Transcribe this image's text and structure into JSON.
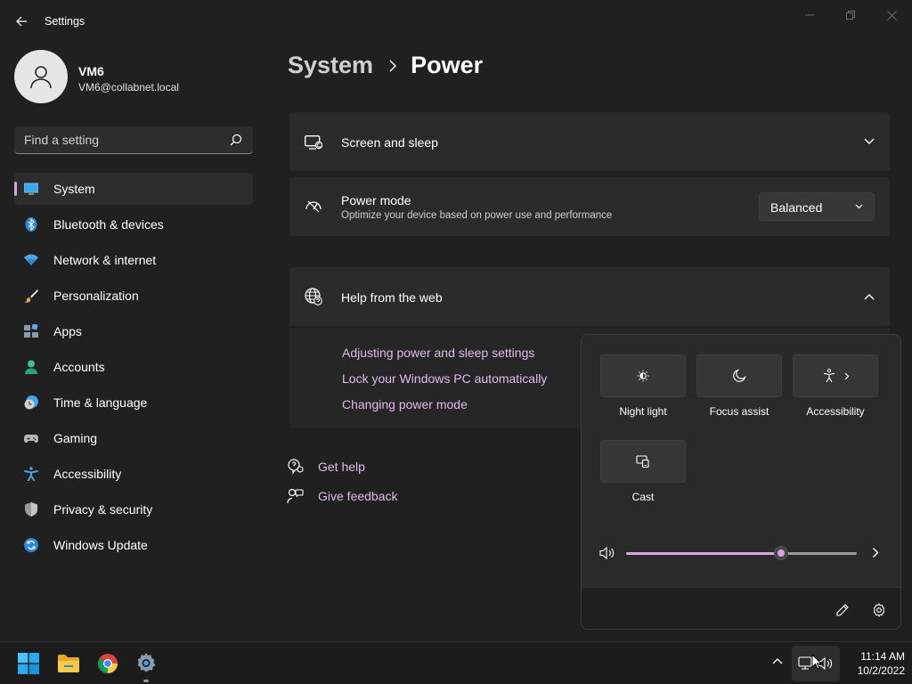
{
  "window": {
    "title": "Settings"
  },
  "profile": {
    "name": "VM6",
    "email": "VM6@collabnet.local"
  },
  "search": {
    "placeholder": "Find a setting"
  },
  "sidebar": {
    "items": [
      {
        "label": "System",
        "icon": "monitor-icon",
        "active": true
      },
      {
        "label": "Bluetooth & devices",
        "icon": "bluetooth-icon"
      },
      {
        "label": "Network & internet",
        "icon": "wifi-icon"
      },
      {
        "label": "Personalization",
        "icon": "brush-icon"
      },
      {
        "label": "Apps",
        "icon": "apps-icon"
      },
      {
        "label": "Accounts",
        "icon": "person-icon"
      },
      {
        "label": "Time & language",
        "icon": "clock-globe-icon"
      },
      {
        "label": "Gaming",
        "icon": "gamepad-icon"
      },
      {
        "label": "Accessibility",
        "icon": "accessibility-icon"
      },
      {
        "label": "Privacy & security",
        "icon": "shield-icon"
      },
      {
        "label": "Windows Update",
        "icon": "update-icon"
      }
    ]
  },
  "breadcrumb": {
    "parent": "System",
    "current": "Power"
  },
  "cards": {
    "screen_sleep": {
      "title": "Screen and sleep"
    },
    "power_mode": {
      "title": "Power mode",
      "subtitle": "Optimize your device based on power use and performance",
      "value": "Balanced"
    },
    "help": {
      "title": "Help from the web",
      "links": [
        "Adjusting power and sleep settings",
        "Lock your Windows PC automatically",
        "Changing power mode"
      ]
    }
  },
  "bottom_links": {
    "get_help": "Get help",
    "give_feedback": "Give feedback"
  },
  "quick_settings": {
    "tiles": [
      {
        "label": "Night light",
        "icon": "night-light-icon"
      },
      {
        "label": "Focus assist",
        "icon": "moon-icon"
      },
      {
        "label": "Accessibility",
        "icon": "accessibility-icon"
      },
      {
        "label": "Cast",
        "icon": "cast-icon"
      }
    ],
    "volume": 0.67
  },
  "taskbar": {
    "time": "11:14 AM",
    "date": "10/2/2022"
  },
  "colors": {
    "accent": "#d9a5e5",
    "link": "#e3b9ee",
    "background": "#202020",
    "card": "#2b2b2b"
  }
}
